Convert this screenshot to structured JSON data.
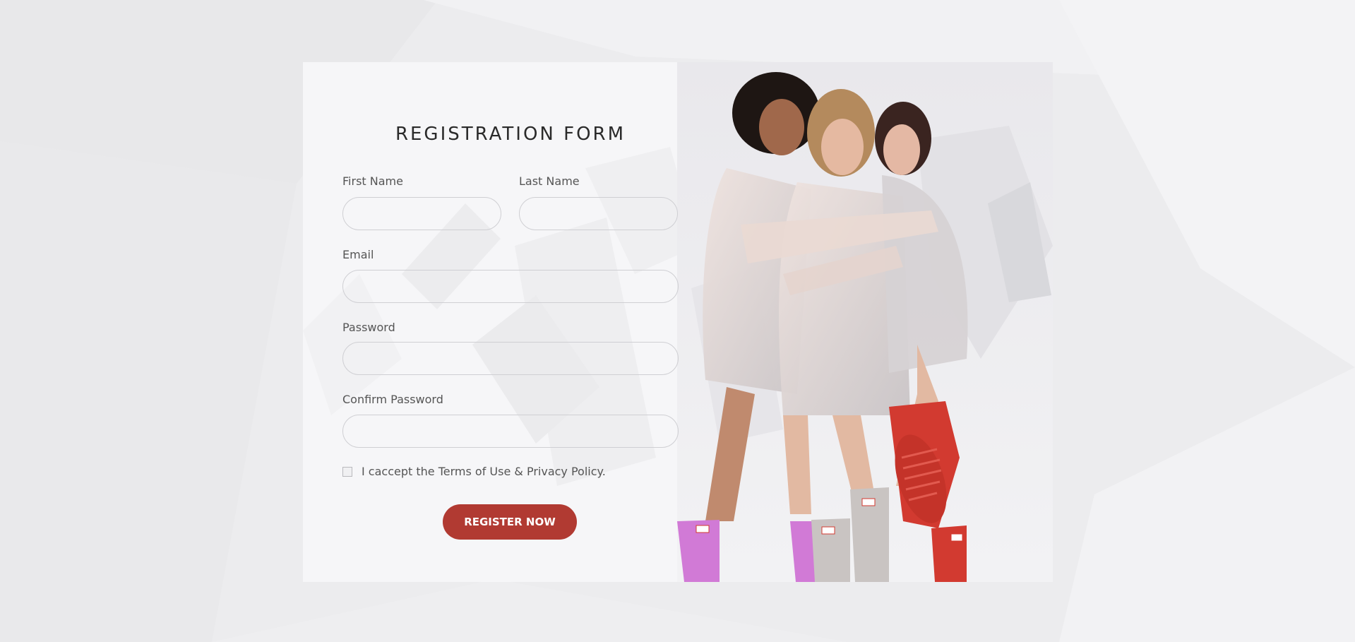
{
  "form": {
    "title": "REGISTRATION FORM",
    "first_name_label": "First Name",
    "first_name_value": "",
    "last_name_label": "Last Name",
    "last_name_value": "",
    "email_label": "Email",
    "email_value": "",
    "password_label": "Password",
    "password_value": "",
    "confirm_password_label": "Confirm Password",
    "confirm_password_value": "",
    "terms_text": "I caccept the Terms of Use & Privacy Policy.",
    "terms_checked": false,
    "submit_label": "REGISTER NOW"
  },
  "colors": {
    "accent": "#b13a32",
    "boot_pink": "#d17ad6",
    "boot_grey": "#c9c4c2",
    "boot_red": "#d23a30",
    "page_bg": "#ececee"
  }
}
